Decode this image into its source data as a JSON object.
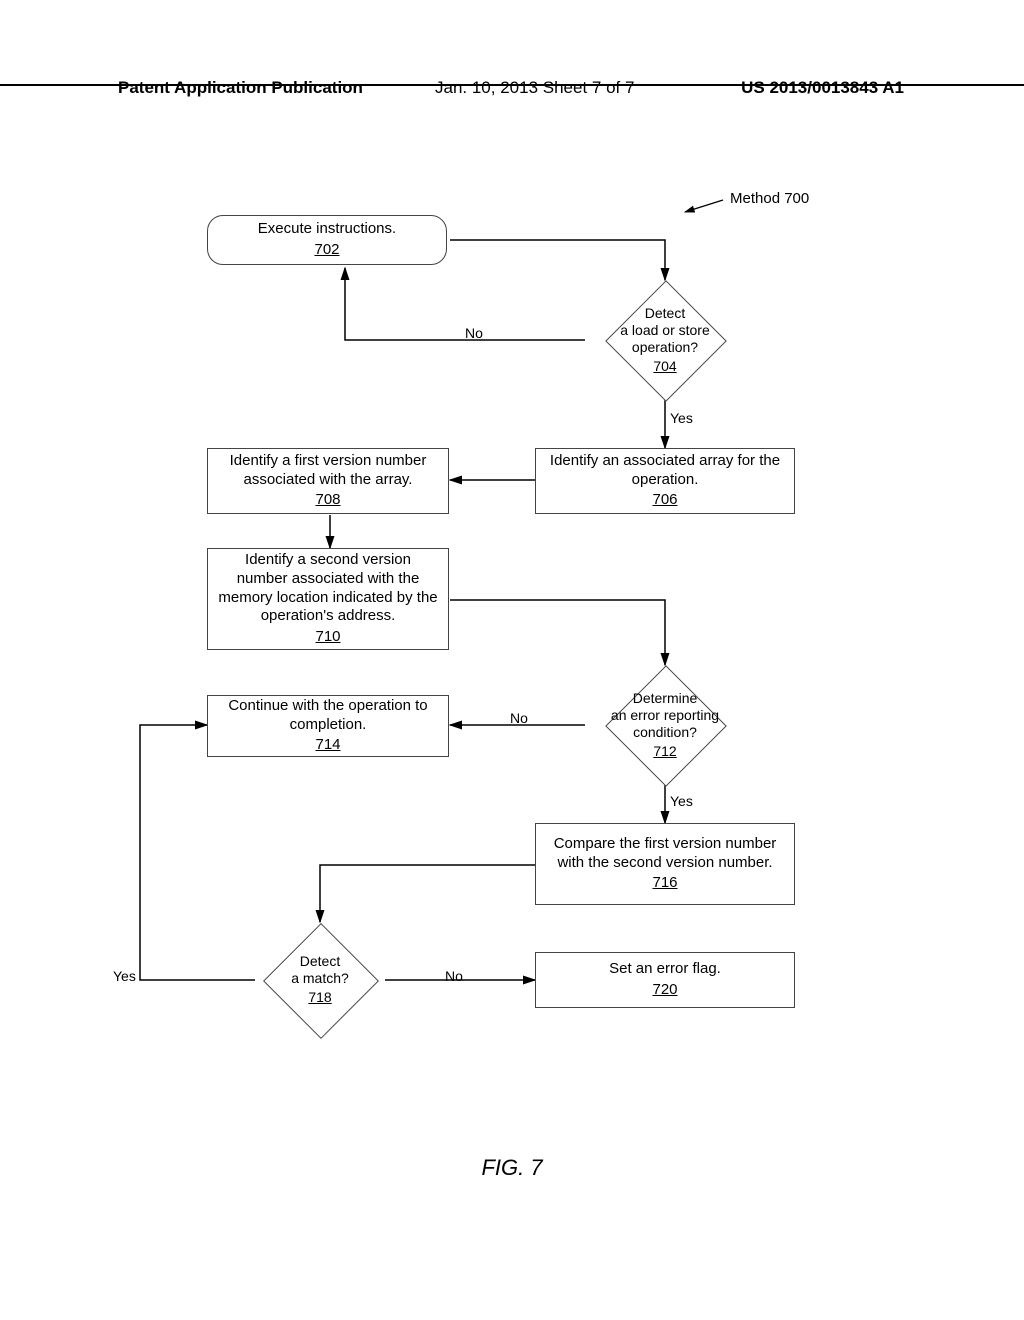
{
  "header": {
    "left": "Patent Application Publication",
    "mid": "Jan. 10, 2013  Sheet 7 of 7",
    "right": "US 2013/0013843 A1"
  },
  "method_label": "Method 700",
  "boxes": {
    "b702": {
      "text": "Execute instructions.",
      "ref": "702"
    },
    "b706": {
      "text": "Identify an associated array for the operation.",
      "ref": "706"
    },
    "b708": {
      "text": "Identify a first version number associated with the array.",
      "ref": "708"
    },
    "b710": {
      "text": "Identify a second version number associated with the memory location indicated by the operation's address.",
      "ref": "710"
    },
    "b714": {
      "text": "Continue with the operation to completion.",
      "ref": "714"
    },
    "b716": {
      "text": "Compare the first version number with the second version number.",
      "ref": "716"
    },
    "b720": {
      "text": "Set an error flag.",
      "ref": "720"
    }
  },
  "diamonds": {
    "d704": {
      "line1": "Detect",
      "line2": "a load or store",
      "line3": "operation?",
      "ref": "704"
    },
    "d712": {
      "line1": "Determine",
      "line2": "an error reporting",
      "line3": "condition?",
      "ref": "712"
    },
    "d718": {
      "line1": "Detect",
      "line2": "a match?",
      "ref": "718"
    }
  },
  "labels": {
    "yes": "Yes",
    "no": "No"
  },
  "figure": "FIG. 7"
}
